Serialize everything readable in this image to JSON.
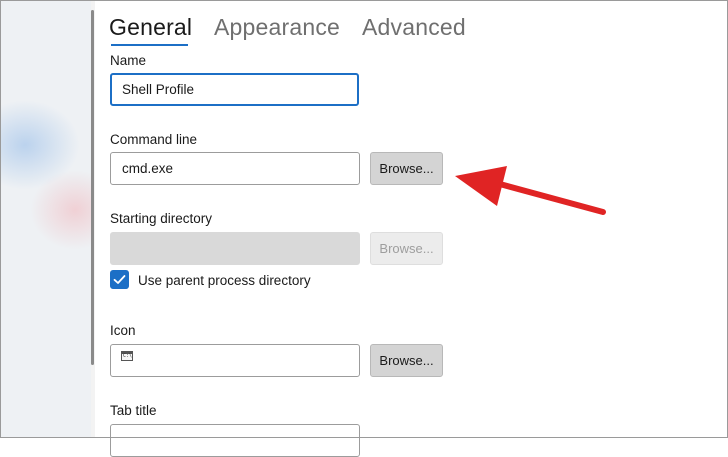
{
  "tabs": [
    {
      "label": "General",
      "active": true
    },
    {
      "label": "Appearance",
      "active": false
    },
    {
      "label": "Advanced",
      "active": false
    }
  ],
  "fields": {
    "name": {
      "label": "Name",
      "value": "Shell Profile"
    },
    "command_line": {
      "label": "Command line",
      "value": "cmd.exe",
      "browse_label": "Browse..."
    },
    "starting_directory": {
      "label": "Starting directory",
      "value": "",
      "browse_label": "Browse...",
      "disabled": true
    },
    "use_parent": {
      "label": "Use parent process directory",
      "checked": true
    },
    "icon": {
      "label": "Icon",
      "value": "",
      "icon_name": "cmd-icon",
      "browse_label": "Browse..."
    },
    "tab_title": {
      "label": "Tab title"
    }
  },
  "colors": {
    "accent": "#1c6fc6",
    "annotation_arrow": "#e02424"
  },
  "icons": {
    "checkbox": "checkmark-icon",
    "annotation": "red-arrow-annotation"
  }
}
